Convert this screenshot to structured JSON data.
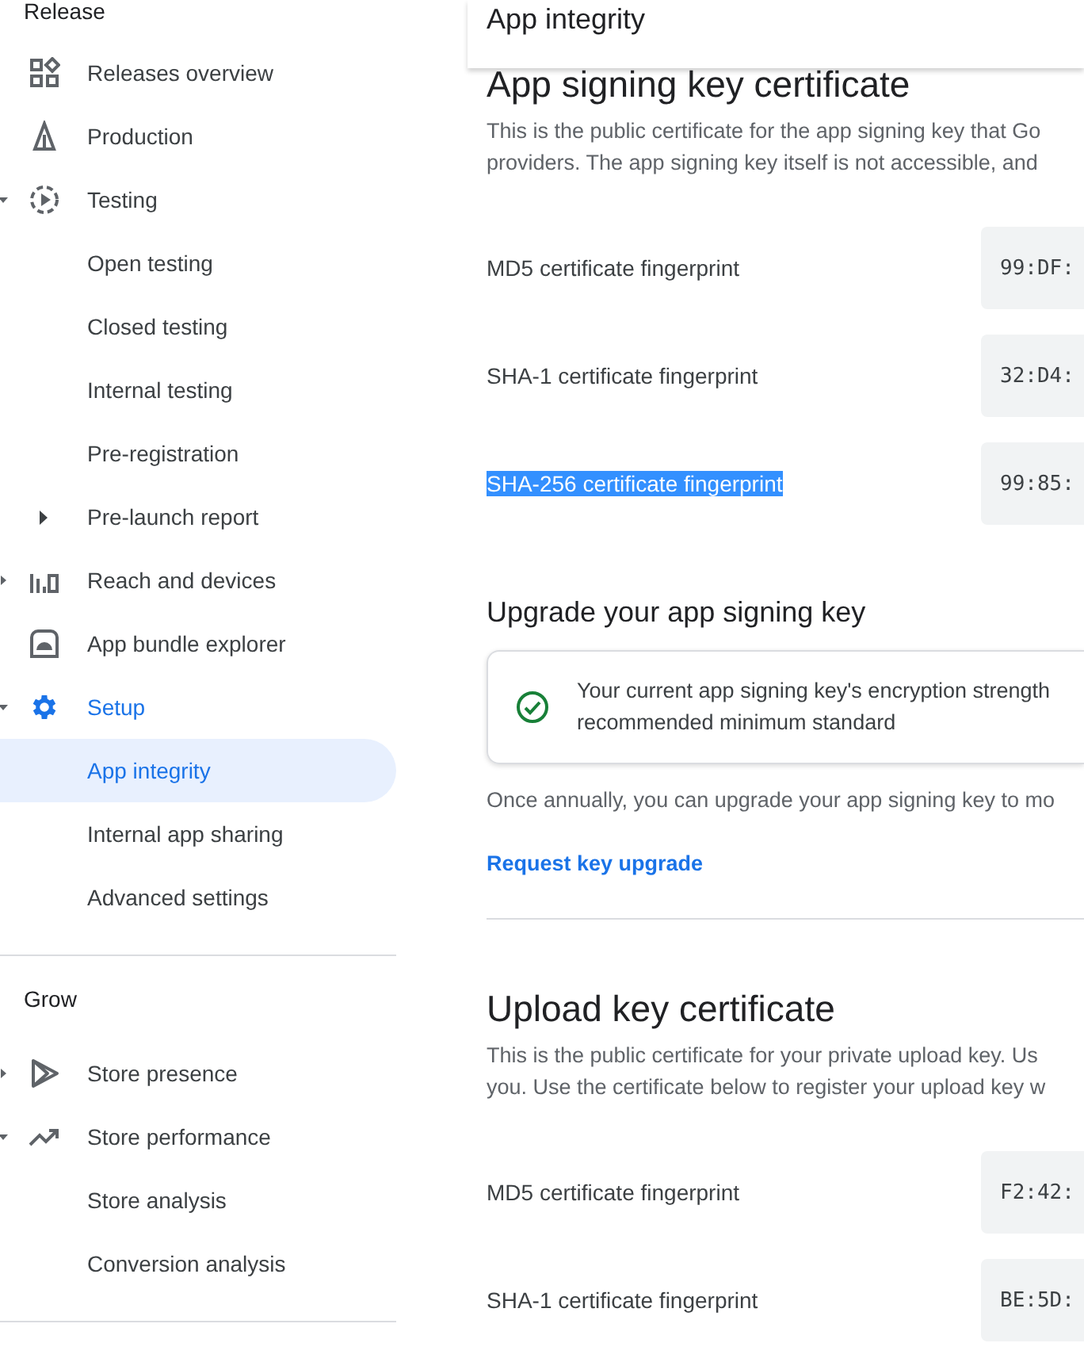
{
  "sidebar": {
    "sections": [
      {
        "label": "Release",
        "items": [
          {
            "label": "Releases overview",
            "kind": "group",
            "active": false,
            "selected": false
          },
          {
            "label": "Production",
            "kind": "group",
            "active": false,
            "selected": false
          },
          {
            "label": "Testing",
            "kind": "group",
            "active": false,
            "expanded": true,
            "selected": false
          },
          {
            "label": "Open testing",
            "kind": "sub",
            "selected": false
          },
          {
            "label": "Closed testing",
            "kind": "sub",
            "selected": false
          },
          {
            "label": "Internal testing",
            "kind": "sub",
            "selected": false
          },
          {
            "label": "Pre-registration",
            "kind": "sub",
            "selected": false
          },
          {
            "label": "Pre-launch report",
            "kind": "sub",
            "expanded": false,
            "selected": false
          },
          {
            "label": "Reach and devices",
            "kind": "group",
            "active": false,
            "expanded": false,
            "selected": false
          },
          {
            "label": "App bundle explorer",
            "kind": "group",
            "active": false,
            "selected": false
          },
          {
            "label": "Setup",
            "kind": "group",
            "active": true,
            "expanded": true,
            "selected": false
          },
          {
            "label": "App integrity",
            "kind": "sub",
            "selected": true
          },
          {
            "label": "Internal app sharing",
            "kind": "sub",
            "selected": false
          },
          {
            "label": "Advanced settings",
            "kind": "sub",
            "selected": false
          }
        ]
      },
      {
        "label": "Grow",
        "items": [
          {
            "label": "Store presence",
            "kind": "group",
            "active": false,
            "expanded": false,
            "selected": false
          },
          {
            "label": "Store performance",
            "kind": "group",
            "active": false,
            "expanded": true,
            "selected": false
          },
          {
            "label": "Store analysis",
            "kind": "sub",
            "selected": false
          },
          {
            "label": "Conversion analysis",
            "kind": "sub",
            "selected": false
          }
        ]
      }
    ]
  },
  "header": {
    "title": "App integrity"
  },
  "signing_certificate": {
    "title": "App signing key certificate",
    "description": [
      "This is the public certificate for the app signing key that Go",
      "providers. The app signing key itself is not accessible, and"
    ],
    "fingerprints": [
      {
        "label": "MD5 certificate fingerprint",
        "value": "99:DF:",
        "highlighted": false
      },
      {
        "label": "SHA-1 certificate fingerprint",
        "value": "32:D4:",
        "highlighted": false
      },
      {
        "label": "SHA-256 certificate fingerprint",
        "value": "99:85:",
        "highlighted": true
      }
    ]
  },
  "upgrade": {
    "title": "Upgrade your app signing key",
    "notice": [
      "Your current app signing key's encryption strength",
      "recommended minimum standard"
    ],
    "body": "Once annually, you can upgrade your app signing key to mo",
    "link": "Request key upgrade"
  },
  "upload_certificate": {
    "title": "Upload key certificate",
    "description": [
      "This is the public certificate for your private upload key. Us",
      "you. Use the certificate below to register your upload key w"
    ],
    "fingerprints": [
      {
        "label": "MD5 certificate fingerprint",
        "value": "F2:42:",
        "highlighted": false
      },
      {
        "label": "SHA-1 certificate fingerprint",
        "value": "BE:5D:",
        "highlighted": false
      }
    ]
  }
}
